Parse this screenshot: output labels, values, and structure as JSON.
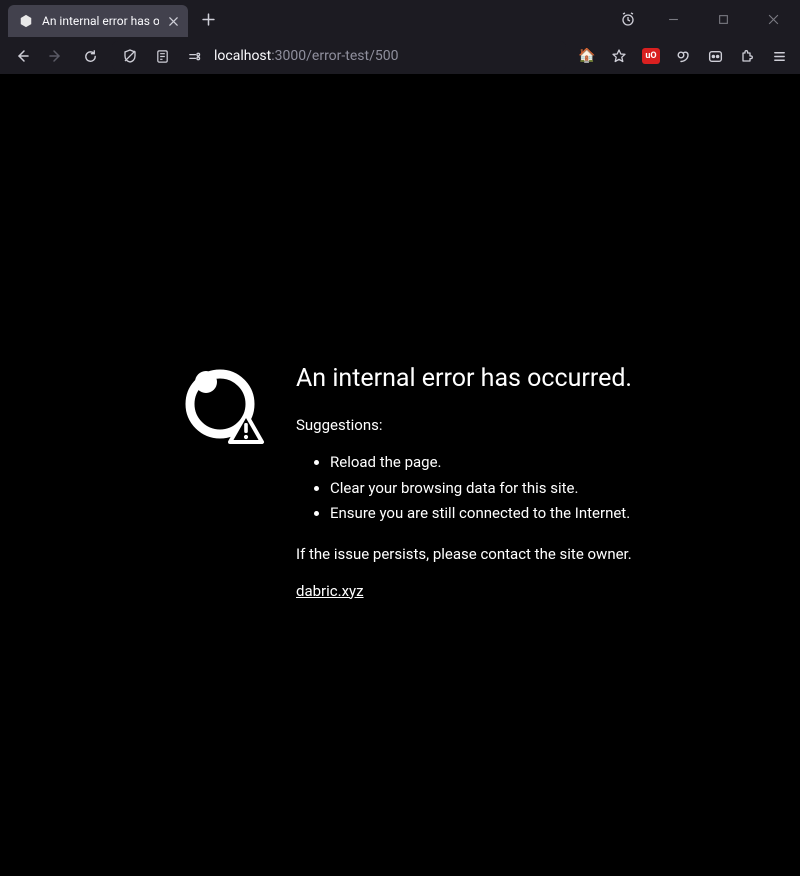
{
  "tab": {
    "title": "An internal error has occurred"
  },
  "url": {
    "host": "localhost",
    "port": ":3000",
    "path": "/error-test/500"
  },
  "ext": {
    "ublock": "uO"
  },
  "error": {
    "title": "An internal error has occurred.",
    "suggestions_label": "Suggestions:",
    "suggestions": {
      "s1": "Reload the page.",
      "s2": "Clear your browsing data for this site.",
      "s3": "Ensure you are still connected to the Internet."
    },
    "persist": "If the issue persists, please contact the site owner.",
    "link": "dabric.xyz"
  }
}
